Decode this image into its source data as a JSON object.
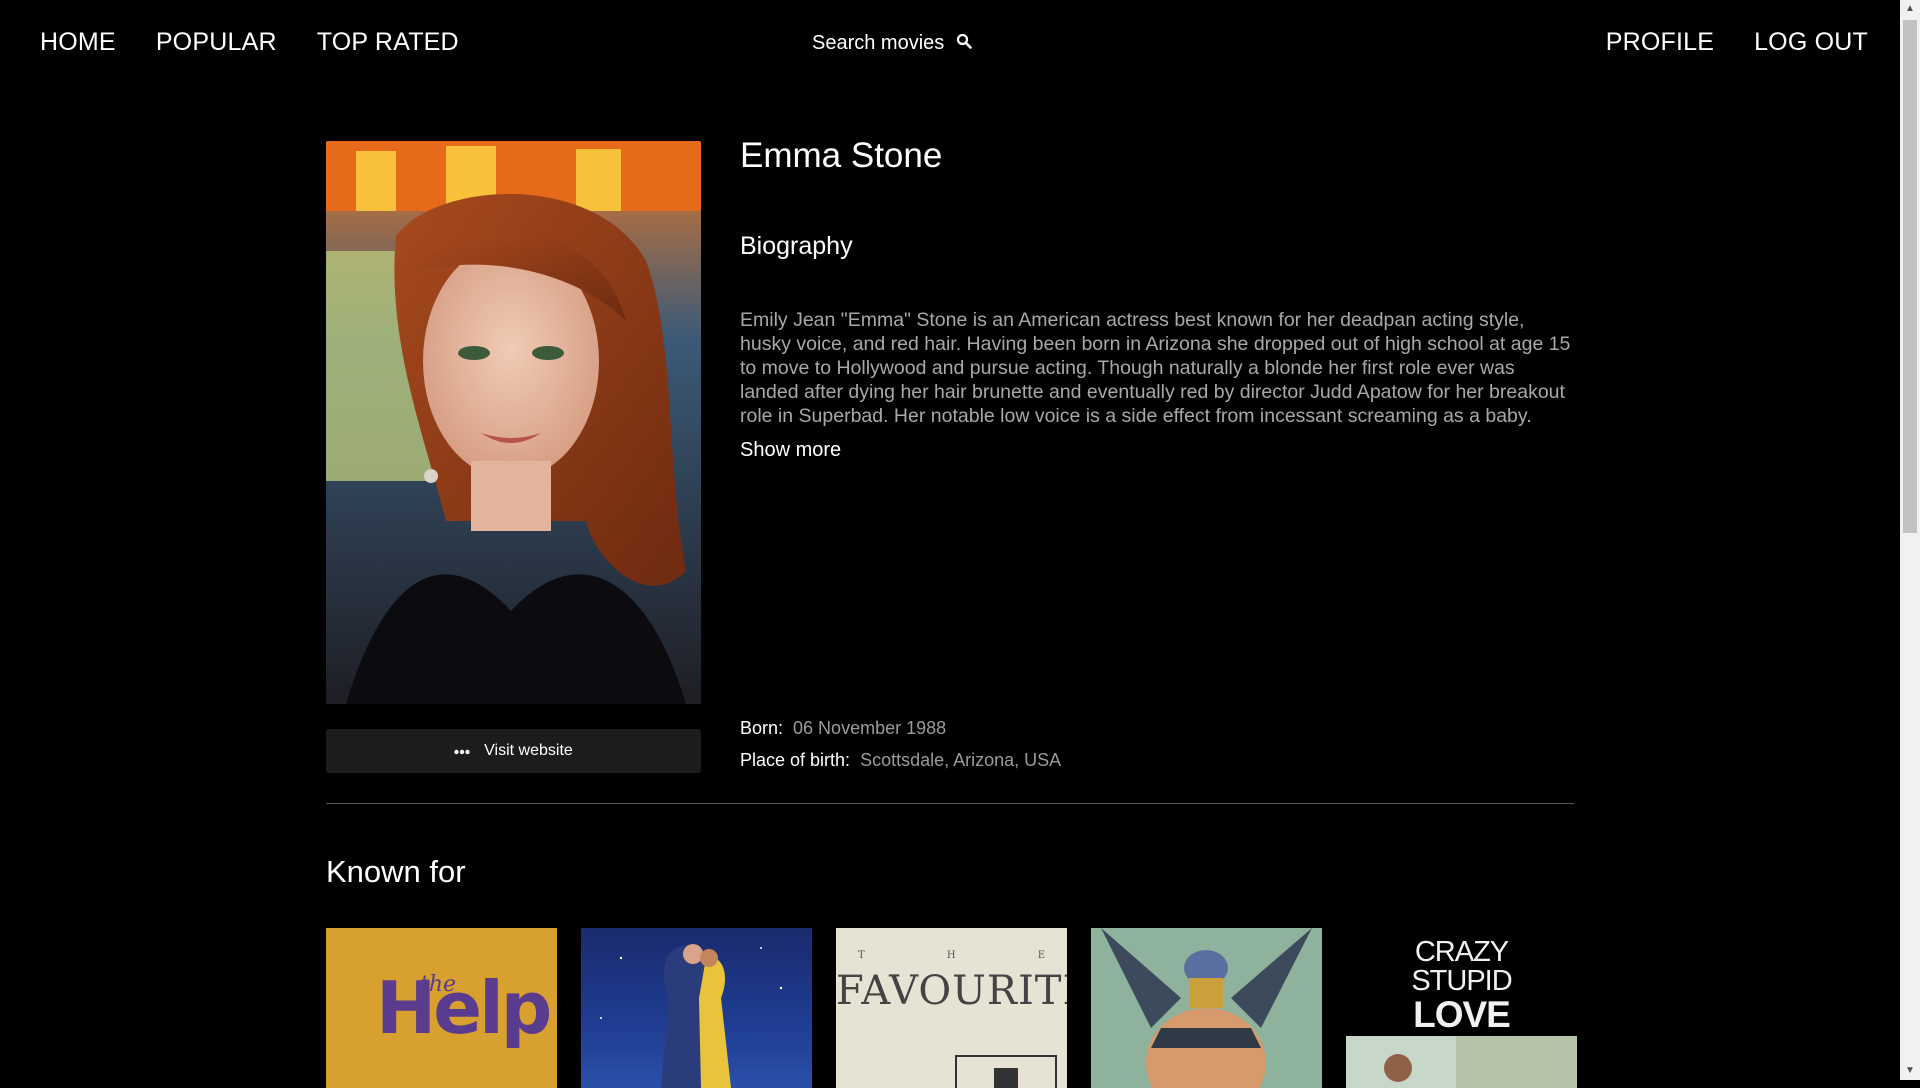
{
  "nav": {
    "left": [
      "HOME",
      "POPULAR",
      "TOP RATED"
    ],
    "search_label": "Search movies",
    "right": [
      "PROFILE",
      "LOG OUT"
    ]
  },
  "person": {
    "name": "Emma Stone",
    "biography_heading": "Biography",
    "biography": "Emily Jean \"Emma\" Stone is an American actress best known for her deadpan acting style, husky voice, and red hair. Having been born in Arizona she dropped out of high school at age 15 to move to Hollywood and pursue acting. Though naturally a blonde her first role ever was landed after dying her hair brunette and eventually red by director Judd Apatow for her breakout role in Superbad. Her notable low voice is a side effect from incessant screaming as a baby.",
    "show_more": "Show more",
    "visit_website": "Visit website",
    "born_label": "Born:",
    "born_value": "06 November 1988",
    "birthplace_label": "Place of birth:",
    "birthplace_value": "Scottsdale, Arizona, USA"
  },
  "known_for": {
    "heading": "Known for",
    "posters": [
      {
        "title_small": "the",
        "title_big": "Help"
      },
      {
        "title": ""
      },
      {
        "prefix": [
          "T",
          "H",
          "E"
        ],
        "title": "FAVOURITE"
      },
      {
        "title": ""
      },
      {
        "lines": [
          "CRAZY",
          "STUPID"
        ],
        "last": "LOVE"
      }
    ]
  },
  "colors": {
    "background": "#000000",
    "muted_text": "#a8a8a8",
    "button_bg": "#1c1c1c"
  }
}
